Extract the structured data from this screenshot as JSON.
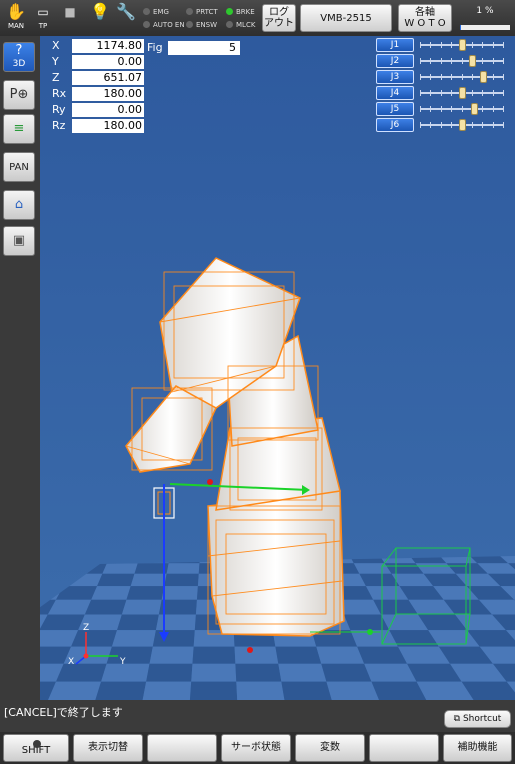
{
  "topbar": {
    "man_label": "MAN",
    "tp_label": "TP",
    "leds": [
      {
        "label": "EMG",
        "on": false
      },
      {
        "label": "PRTCT",
        "on": false
      },
      {
        "label": "BRKE",
        "on": true
      },
      {
        "label": "AUTO EN",
        "on": false
      },
      {
        "label": "ENSW",
        "on": false
      },
      {
        "label": "MLCK",
        "on": false
      }
    ],
    "log_button": {
      "line1": "ログ",
      "line2": "アウト"
    },
    "robot_button": "VMB-2515",
    "frame_button": {
      "line1": "各軸",
      "line2": "W O T O"
    },
    "speed": {
      "label": "1 %",
      "value_percent": 1
    }
  },
  "sidebar": {
    "buttons": [
      {
        "name": "help-3d",
        "label": "3D",
        "glyph": "?",
        "active": true
      },
      {
        "name": "robot-select",
        "label": "",
        "glyph": "P⊕",
        "active": false
      },
      {
        "name": "layers",
        "label": "",
        "glyph": "≡",
        "active": false
      },
      {
        "name": "pan",
        "label": "PAN",
        "glyph": "",
        "active": false
      },
      {
        "name": "home",
        "label": "",
        "glyph": "⌂",
        "active": false
      },
      {
        "name": "cube",
        "label": "",
        "glyph": "▣",
        "active": false
      }
    ]
  },
  "coordinates": {
    "rows": [
      {
        "label": "X",
        "value": "1174.80"
      },
      {
        "label": "Y",
        "value": "0.00"
      },
      {
        "label": "Z",
        "value": "651.07"
      },
      {
        "label": "Rx",
        "value": "180.00"
      },
      {
        "label": "Ry",
        "value": "0.00"
      },
      {
        "label": "Rz",
        "value": "180.00"
      }
    ],
    "fig_label": "Fig",
    "fig_value": "5"
  },
  "joints": [
    {
      "label": "J1",
      "position": 0.5
    },
    {
      "label": "J2",
      "position": 0.62
    },
    {
      "label": "J3",
      "position": 0.75
    },
    {
      "label": "J4",
      "position": 0.5
    },
    {
      "label": "J5",
      "position": 0.65
    },
    {
      "label": "J6",
      "position": 0.5
    }
  ],
  "axes": {
    "x": "X",
    "y": "Y",
    "z": "Z"
  },
  "colors": {
    "robot_body": "#f7f3ee",
    "robot_wire": "#ff8a1a",
    "floor_a": "#4a78b8",
    "floor_b": "#2e5894",
    "tool_axis": "#1a3cff",
    "x_axis": "#1bd22a",
    "bounding_box": "#1bc94a"
  },
  "status": {
    "message": "[CANCEL]で終了します",
    "shortcut": "Shortcut"
  },
  "bottombar": {
    "buttons": [
      "SHIFT",
      "表示切替",
      "",
      "サーボ状態",
      "変数",
      "",
      "補助機能"
    ]
  }
}
